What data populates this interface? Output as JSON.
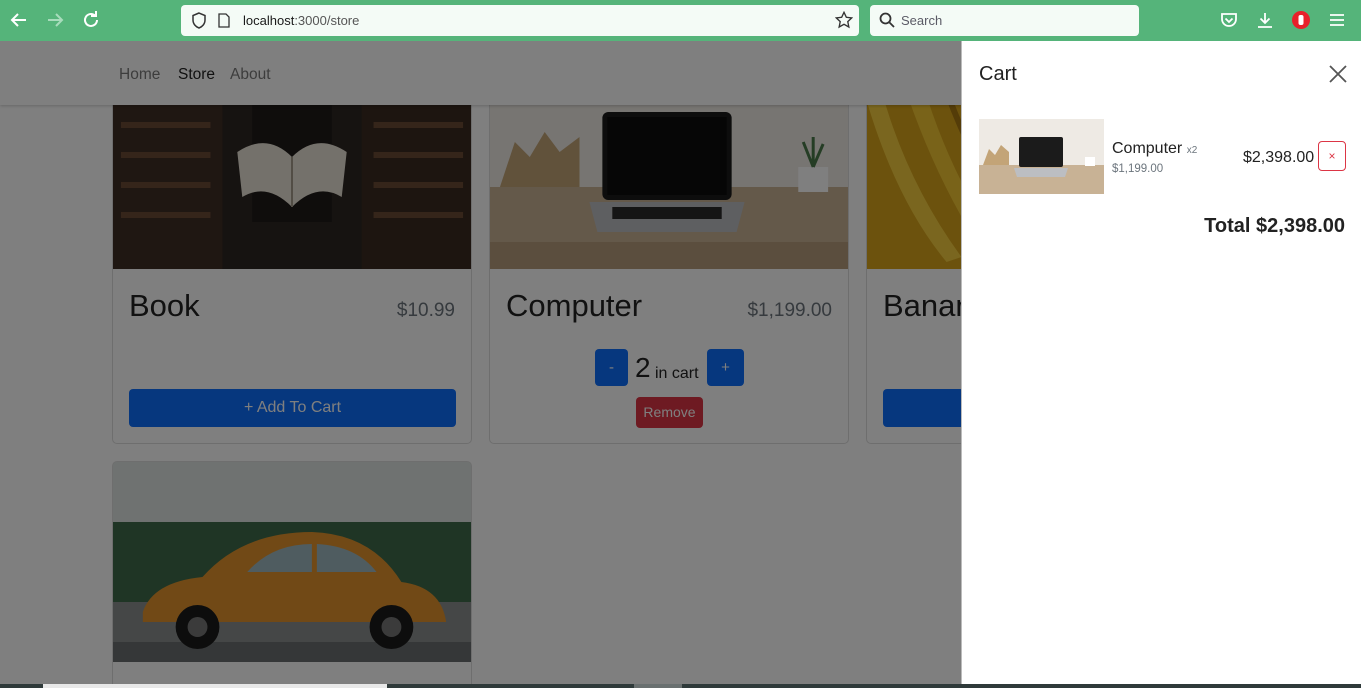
{
  "browser": {
    "url_host": "localhost",
    "url_path": ":3000/store",
    "search_placeholder": "Search"
  },
  "navbar": {
    "links": [
      {
        "label": "Home",
        "active": false
      },
      {
        "label": "Store",
        "active": true
      },
      {
        "label": "About",
        "active": false
      }
    ]
  },
  "store": {
    "items": [
      {
        "name": "Book",
        "price": "$10.99",
        "add_label": "+ Add To Cart"
      },
      {
        "name": "Computer",
        "price": "$1,199.00",
        "quantity": "2",
        "in_cart_label": "in cart",
        "minus_label": "-",
        "plus_label": "+",
        "remove_label": "Remove"
      },
      {
        "name": "Banana",
        "price": "",
        "add_label": ""
      },
      {
        "name": "Car",
        "price": "",
        "add_label": ""
      }
    ]
  },
  "cart": {
    "title": "Cart",
    "items": [
      {
        "name": "Computer",
        "qty": "x2",
        "unit_price": "$1,199.00",
        "line_total": "$2,398.00",
        "remove_label": "×"
      }
    ],
    "total": "Total $2,398.00"
  },
  "colors": {
    "browser_bar": "#55b47a",
    "primary": "#0d6efd",
    "danger": "#dc3545"
  }
}
